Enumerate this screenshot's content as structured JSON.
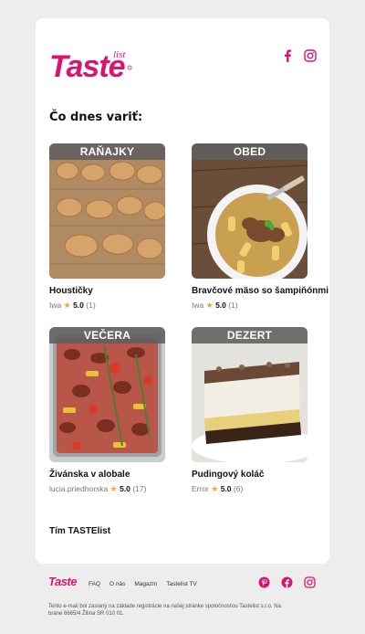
{
  "brand": {
    "name": "Taste",
    "sub": "list",
    "color": "#d8166f"
  },
  "heading": "Čo dnes variť:",
  "recipes": [
    {
      "category": "RAŇAJKY",
      "title": "Houstičky",
      "author": "Iwa",
      "rating": "5.0",
      "count": "(1)"
    },
    {
      "category": "OBED",
      "title": "Bravčové mäso so šampiňónmi",
      "author": "Iwa",
      "rating": "5.0",
      "count": "(1)"
    },
    {
      "category": "VEČERA",
      "title": "Živánska v alobale",
      "author": "lucia.priedhorska",
      "rating": "5.0",
      "count": "(17)"
    },
    {
      "category": "DEZERT",
      "title": "Pudingový koláč",
      "author": "Error",
      "rating": "5.0",
      "count": "(6)"
    }
  ],
  "star": "★",
  "signoff": "Tím TASTElist",
  "footer": {
    "nav": [
      "FAQ",
      "O nás",
      "Magazín",
      "Tastelist TV"
    ],
    "disclaimer": "Tento e-mail bol zaslaný na základe registrácie na našej stránke spoločnosťou Tastelist s.r.o. Na bráne 8665/4 Žilina SR 010 01."
  },
  "icons": {
    "top": [
      "facebook-icon",
      "instagram-icon"
    ],
    "bottom": [
      "pinterest-icon",
      "facebook-icon",
      "instagram-icon"
    ]
  }
}
